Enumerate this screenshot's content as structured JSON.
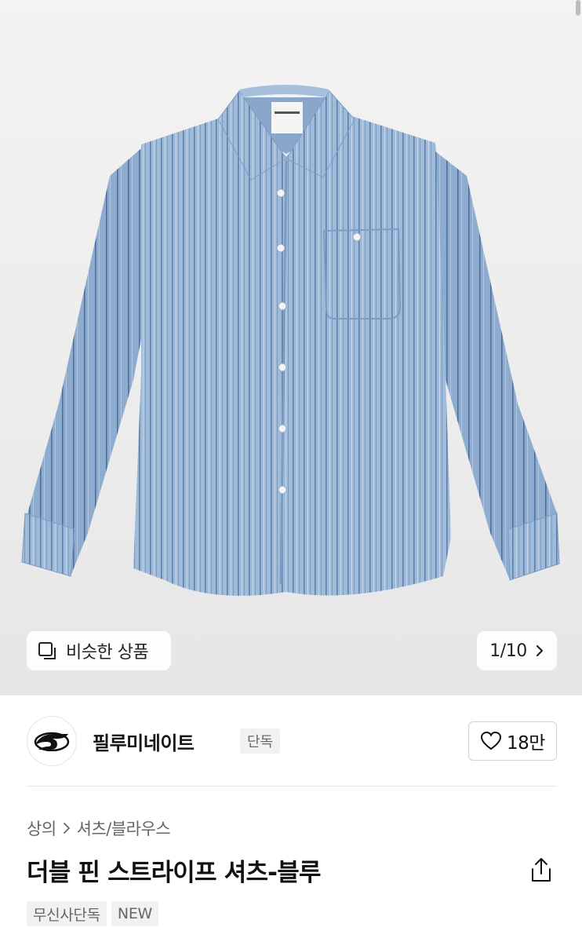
{
  "gallery": {
    "similar_label": "비슷한 상품",
    "counter": "1/10"
  },
  "brand": {
    "name": "필루미네이트",
    "badge": "단독",
    "likes": "18만"
  },
  "product": {
    "breadcrumb": [
      "상의",
      "셔츠/블라우스"
    ],
    "title": "더블 핀 스트라이프 셔츠-블루",
    "tags": [
      "무신사단독",
      "NEW"
    ]
  },
  "colors": {
    "shirt": "#9cb8d8",
    "stripe": "#6f8fb8",
    "background": "#eeeeee"
  }
}
